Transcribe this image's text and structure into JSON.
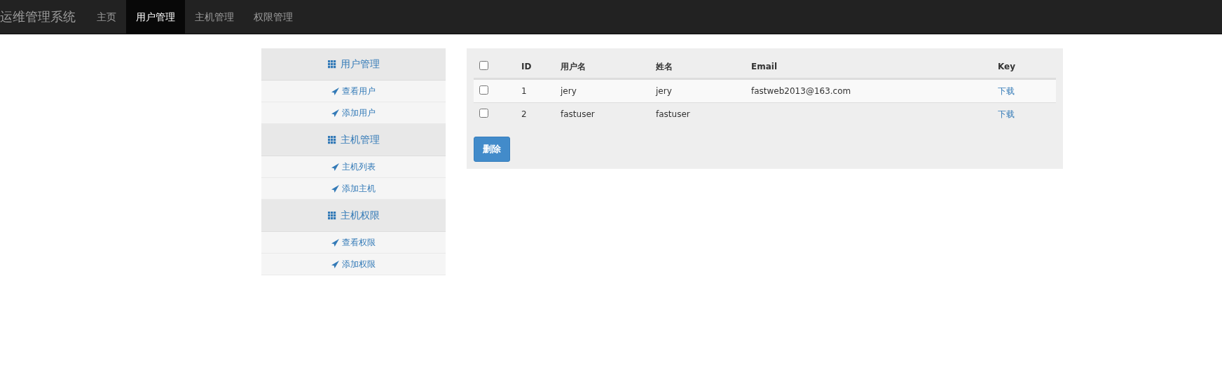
{
  "navbar": {
    "brand": "运维管理系统",
    "items": [
      {
        "label": "主页",
        "selected": false
      },
      {
        "label": "用户管理",
        "selected": true
      },
      {
        "label": "主机管理",
        "selected": false
      },
      {
        "label": "权限管理",
        "selected": false
      }
    ]
  },
  "sidebar": {
    "groups": [
      {
        "title": "用户管理",
        "items": [
          "查看用户",
          "添加用户"
        ]
      },
      {
        "title": "主机管理",
        "items": [
          "主机列表",
          "添加主机"
        ]
      },
      {
        "title": "主机权限",
        "items": [
          "查看权限",
          "添加权限"
        ]
      }
    ]
  },
  "table": {
    "select_all": {
      "checked": false
    },
    "columns": [
      "ID",
      "用户名",
      "姓名",
      "Email",
      "Key"
    ],
    "rows": [
      {
        "checked": false,
        "cells": [
          "1",
          "jery",
          "jery",
          "fastweb2013@163.com"
        ],
        "key": "下载"
      },
      {
        "checked": false,
        "cells": [
          "2",
          "fastuser",
          "fastuser",
          ""
        ],
        "key": "下载"
      }
    ]
  },
  "delete_button": "删除"
}
